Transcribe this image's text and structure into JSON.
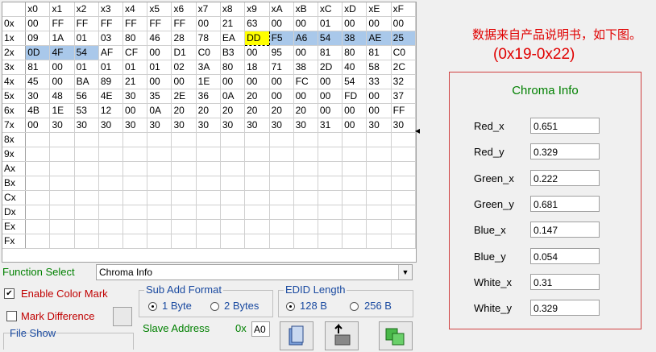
{
  "grid": {
    "columns": [
      "x0",
      "x1",
      "x2",
      "x3",
      "x4",
      "x5",
      "x6",
      "x7",
      "x8",
      "x9",
      "xA",
      "xB",
      "xC",
      "xD",
      "xE",
      "xF"
    ],
    "rows": [
      {
        "label": "0x",
        "cells": [
          "00",
          "FF",
          "FF",
          "FF",
          "FF",
          "FF",
          "FF",
          "00",
          "21",
          "63",
          "00",
          "00",
          "01",
          "00",
          "00",
          "00"
        ]
      },
      {
        "label": "1x",
        "cells": [
          "09",
          "1A",
          "01",
          "03",
          "80",
          "46",
          "28",
          "78",
          "EA",
          "DD",
          "F5",
          "A6",
          "54",
          "38",
          "AE",
          "25"
        ]
      },
      {
        "label": "2x",
        "cells": [
          "0D",
          "4F",
          "54",
          "AF",
          "CF",
          "00",
          "D1",
          "C0",
          "B3",
          "00",
          "95",
          "00",
          "81",
          "80",
          "81",
          "C0"
        ]
      },
      {
        "label": "3x",
        "cells": [
          "81",
          "00",
          "01",
          "01",
          "01",
          "01",
          "02",
          "3A",
          "80",
          "18",
          "71",
          "38",
          "2D",
          "40",
          "58",
          "2C"
        ]
      },
      {
        "label": "4x",
        "cells": [
          "45",
          "00",
          "BA",
          "89",
          "21",
          "00",
          "00",
          "1E",
          "00",
          "00",
          "00",
          "FC",
          "00",
          "54",
          "33",
          "32"
        ]
      },
      {
        "label": "5x",
        "cells": [
          "30",
          "48",
          "56",
          "4E",
          "30",
          "35",
          "2E",
          "36",
          "0A",
          "20",
          "00",
          "00",
          "00",
          "FD",
          "00",
          "37"
        ]
      },
      {
        "label": "6x",
        "cells": [
          "4B",
          "1E",
          "53",
          "12",
          "00",
          "0A",
          "20",
          "20",
          "20",
          "20",
          "20",
          "20",
          "00",
          "00",
          "00",
          "FF"
        ]
      },
      {
        "label": "7x",
        "cells": [
          "00",
          "30",
          "30",
          "30",
          "30",
          "30",
          "30",
          "30",
          "30",
          "30",
          "30",
          "30",
          "31",
          "00",
          "30",
          "30"
        ]
      },
      {
        "label": "8x",
        "cells": [
          "",
          "",
          "",
          "",
          "",
          "",
          "",
          "",
          "",
          "",
          "",
          "",
          "",
          "",
          "",
          ""
        ]
      },
      {
        "label": "9x",
        "cells": [
          "",
          "",
          "",
          "",
          "",
          "",
          "",
          "",
          "",
          "",
          "",
          "",
          "",
          "",
          "",
          ""
        ]
      },
      {
        "label": "Ax",
        "cells": [
          "",
          "",
          "",
          "",
          "",
          "",
          "",
          "",
          "",
          "",
          "",
          "",
          "",
          "",
          "",
          ""
        ]
      },
      {
        "label": "Bx",
        "cells": [
          "",
          "",
          "",
          "",
          "",
          "",
          "",
          "",
          "",
          "",
          "",
          "",
          "",
          "",
          "",
          ""
        ]
      },
      {
        "label": "Cx",
        "cells": [
          "",
          "",
          "",
          "",
          "",
          "",
          "",
          "",
          "",
          "",
          "",
          "",
          "",
          "",
          "",
          ""
        ]
      },
      {
        "label": "Dx",
        "cells": [
          "",
          "",
          "",
          "",
          "",
          "",
          "",
          "",
          "",
          "",
          "",
          "",
          "",
          "",
          "",
          ""
        ]
      },
      {
        "label": "Ex",
        "cells": [
          "",
          "",
          "",
          "",
          "",
          "",
          "",
          "",
          "",
          "",
          "",
          "",
          "",
          "",
          "",
          ""
        ]
      },
      {
        "label": "Fx",
        "cells": [
          "",
          "",
          "",
          "",
          "",
          "",
          "",
          "",
          "",
          "",
          "",
          "",
          "",
          "",
          "",
          ""
        ]
      }
    ]
  },
  "note": {
    "text": "数据来自产品说明书，如下图。",
    "range": "(0x19-0x22)"
  },
  "chroma": {
    "title": "Chroma Info",
    "fields": [
      {
        "label": "Red_x",
        "value": "0.651"
      },
      {
        "label": "Red_y",
        "value": "0.329"
      },
      {
        "label": "Green_x",
        "value": "0.222"
      },
      {
        "label": "Green_y",
        "value": "0.681"
      },
      {
        "label": "Blue_x",
        "value": "0.147"
      },
      {
        "label": "Blue_y",
        "value": "0.054"
      },
      {
        "label": "White_x",
        "value": "0.31"
      },
      {
        "label": "White_y",
        "value": "0.329"
      }
    ]
  },
  "controls": {
    "function_label": "Function Select",
    "function_value": "Chroma Info",
    "enable_color_mark": "Enable Color Mark",
    "mark_difference": "Mark Difference",
    "file_show": "File Show",
    "sub_add_format": "Sub Add Format",
    "opt_1byte": "1 Byte",
    "opt_2bytes": "2 Bytes",
    "edid_length": "EDID Length",
    "opt_128": "128 B",
    "opt_256": "256 B",
    "slave_address": "Slave Address",
    "slave_prefix": "0x",
    "slave_value": "A0"
  },
  "colors": {
    "selection": "#a9c8ea",
    "mark": "#ffff00",
    "accent_green": "#008000",
    "accent_red": "#c00000"
  }
}
